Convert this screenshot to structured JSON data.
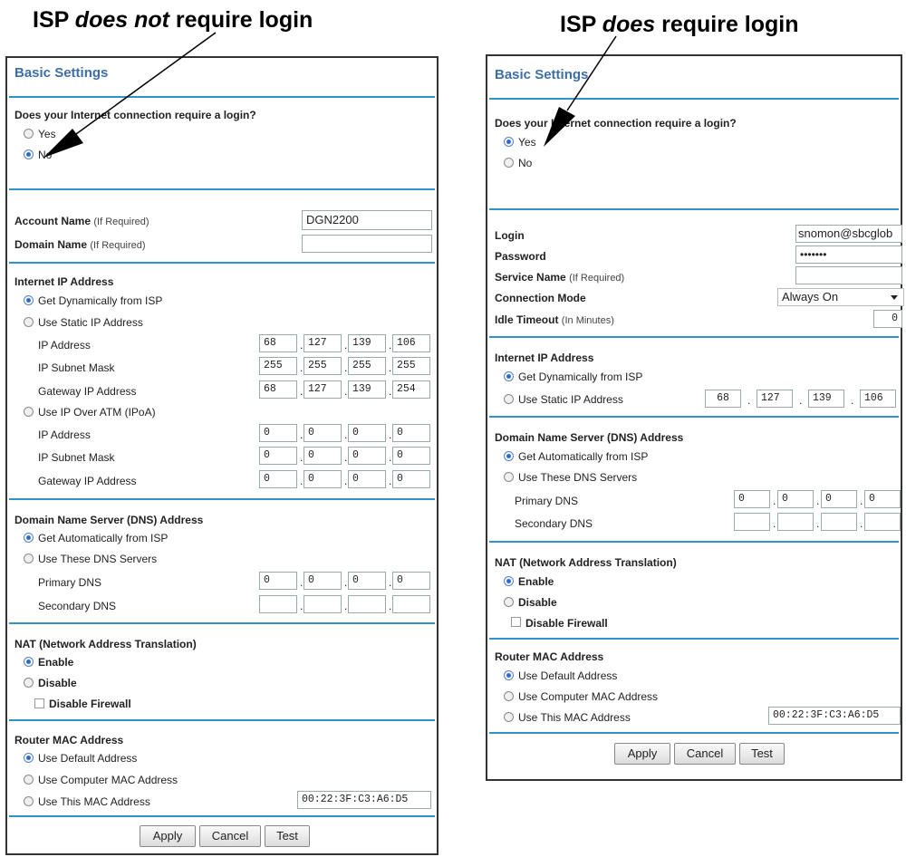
{
  "captions": {
    "left": {
      "pre": "ISP ",
      "em": "does not",
      "post": " require login"
    },
    "right": {
      "pre": "ISP ",
      "em": "does",
      "post": " require login"
    }
  },
  "left": {
    "title": "Basic Settings",
    "login_question": "Does your Internet connection require a login?",
    "opt_yes": "Yes",
    "opt_no": "No",
    "account_name_label": "Account Name",
    "account_name_hint": "(If Required)",
    "account_name_value": "DGN2200",
    "domain_name_label": "Domain Name",
    "domain_name_hint": "(If Required)",
    "domain_name_value": "",
    "internet_ip_heading": "Internet IP Address",
    "get_dynamic": "Get Dynamically from ISP",
    "use_static": "Use Static IP Address",
    "ip_address_label": "IP Address",
    "subnet_label": "IP Subnet Mask",
    "gateway_label": "Gateway IP Address",
    "static_ip": [
      "68",
      "127",
      "139",
      "106"
    ],
    "static_mask": [
      "255",
      "255",
      "255",
      "255"
    ],
    "static_gw": [
      "68",
      "127",
      "139",
      "254"
    ],
    "use_ipoa": "Use IP Over ATM (IPoA)",
    "ipoa_ip_label": "IP Address",
    "ipoa_mask_label": "IP Subnet Mask",
    "ipoa_gw_label": "Gateway IP Address",
    "ipoa_ip": [
      "0",
      "0",
      "0",
      "0"
    ],
    "ipoa_mask": [
      "0",
      "0",
      "0",
      "0"
    ],
    "ipoa_gw": [
      "0",
      "0",
      "0",
      "0"
    ],
    "dns_heading": "Domain Name Server (DNS) Address",
    "dns_auto": "Get Automatically from ISP",
    "dns_manual": "Use These DNS Servers",
    "primary_dns_label": "Primary DNS",
    "secondary_dns_label": "Secondary DNS",
    "primary_dns": [
      "0",
      "0",
      "0",
      "0"
    ],
    "secondary_dns": [
      "",
      "",
      "",
      ""
    ],
    "nat_heading": "NAT (Network Address Translation)",
    "nat_enable": "Enable",
    "nat_disable": "Disable",
    "disable_firewall": "Disable Firewall",
    "mac_heading": "Router MAC Address",
    "mac_default": "Use Default Address",
    "mac_computer": "Use Computer MAC Address",
    "mac_this": "Use This MAC Address",
    "mac_value": "00:22:3F:C3:A6:D5",
    "apply": "Apply",
    "cancel": "Cancel",
    "test": "Test"
  },
  "right": {
    "title": "Basic Settings",
    "login_question": "Does your Internet connection require a login?",
    "opt_yes": "Yes",
    "opt_no": "No",
    "login_label": "Login",
    "login_value": "snomon@sbcglob",
    "password_label": "Password",
    "password_value": "•••••••",
    "service_label": "Service Name",
    "service_hint": "(If Required)",
    "service_value": "",
    "conn_mode_label": "Connection Mode",
    "conn_mode_value": "Always On",
    "idle_label": "Idle Timeout",
    "idle_hint": "(In Minutes)",
    "idle_value": "0",
    "internet_ip_heading": "Internet IP Address",
    "get_dynamic": "Get Dynamically from ISP",
    "use_static": "Use Static IP Address",
    "static_ip": [
      "68",
      "127",
      "139",
      "106"
    ],
    "dns_heading": "Domain Name Server (DNS) Address",
    "dns_auto": "Get Automatically from ISP",
    "dns_manual": "Use These DNS Servers",
    "primary_dns_label": "Primary DNS",
    "secondary_dns_label": "Secondary DNS",
    "primary_dns": [
      "0",
      "0",
      "0",
      "0"
    ],
    "secondary_dns": [
      "",
      "",
      "",
      ""
    ],
    "nat_heading": "NAT (Network Address Translation)",
    "nat_enable": "Enable",
    "nat_disable": "Disable",
    "disable_firewall": "Disable Firewall",
    "mac_heading": "Router MAC Address",
    "mac_default": "Use Default Address",
    "mac_computer": "Use Computer MAC Address",
    "mac_this": "Use This MAC Address",
    "mac_value": "00:22:3F:C3:A6:D5",
    "apply": "Apply",
    "cancel": "Cancel",
    "test": "Test"
  },
  "colors": {
    "heading": "#3d6ea8",
    "rule": "#2f95c8",
    "frame": "#333333"
  }
}
